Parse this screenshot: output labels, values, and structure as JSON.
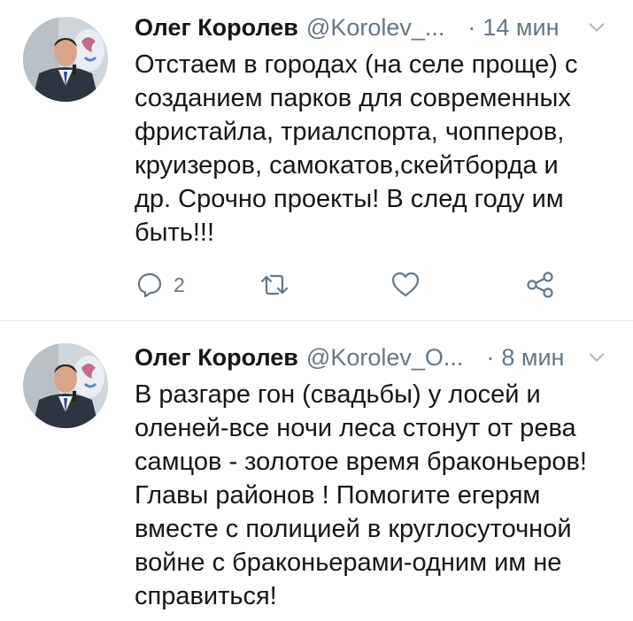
{
  "tweets": [
    {
      "author_name": "Олег Королев",
      "handle": "@Korolev_...",
      "separator": "·",
      "time": "14 мин",
      "text": "Отстаем в городах (на селе проще) с\nсозданием парков для современных\nфристайла, триалспорта, чопперов,\nкруизеров, самокатов,скейтборда и\nдр. Срочно проекты! В след году им\nбыть!!!",
      "reply_count": "2",
      "icons": [
        "chevron-down-icon",
        "reply-icon",
        "retweet-icon",
        "like-icon",
        "share-icon"
      ]
    },
    {
      "author_name": "Олег Королев",
      "handle": "@Korolev_O...",
      "separator": "·",
      "time": "8 мин",
      "text": "В разгаре гон (свадьбы) у лосей и\nоленей-все ночи леса стонут от рева\nсамцов - золотое время браконьеров!\nГлавы районов ! Помогите егерям\nвместе с полицией в круглосуточной\nвойне с браконьерами-одним им не\nсправиться!",
      "icons": [
        "chevron-down-icon"
      ]
    }
  ],
  "colors": {
    "text": "#14171a",
    "secondary": "#657786",
    "divider": "#e1e8ed"
  }
}
